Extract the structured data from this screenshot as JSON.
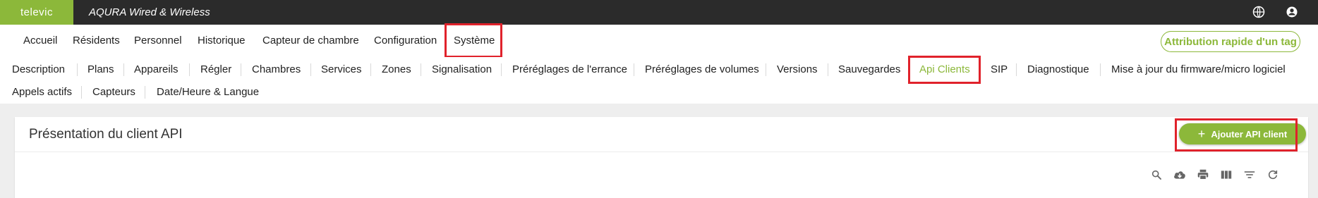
{
  "topbar": {
    "logo_text": "televic",
    "app_title": "AQURA Wired & Wireless",
    "icons": [
      "globe-icon",
      "account-icon"
    ]
  },
  "main_nav": {
    "items": [
      "Accueil",
      "Résidents",
      "Personnel",
      "Historique",
      "Capteur de chambre",
      "Configuration",
      "Système"
    ],
    "active": "Système",
    "quick_tag_label": "Attribution rapide d'un tag"
  },
  "sub_nav": {
    "row1": [
      "Description",
      "Plans",
      "Appareils",
      "Régler",
      "Chambres",
      "Services",
      "Zones",
      "Signalisation",
      "Préréglages de l'errance",
      "Préréglages de volumes",
      "Versions",
      "Sauvegardes",
      "Api Clients",
      "SIP",
      "Diagnostique",
      "Mise à jour du firmware/micro logiciel"
    ],
    "row2": [
      "Appels actifs",
      "Capteurs",
      "Date/Heure & Langue"
    ],
    "active": "Api Clients"
  },
  "card": {
    "title": "Présentation du client API",
    "add_button_label": "Ajouter API client",
    "toolbar_icons": [
      "search-icon",
      "cloud-download-icon",
      "print-icon",
      "columns-icon",
      "filter-icon",
      "refresh-icon"
    ]
  },
  "colors": {
    "brand_green": "#8cb83a",
    "topbar_bg": "#2b2b2b",
    "highlight_red": "#e0222b",
    "page_bg": "#eeeeee"
  }
}
